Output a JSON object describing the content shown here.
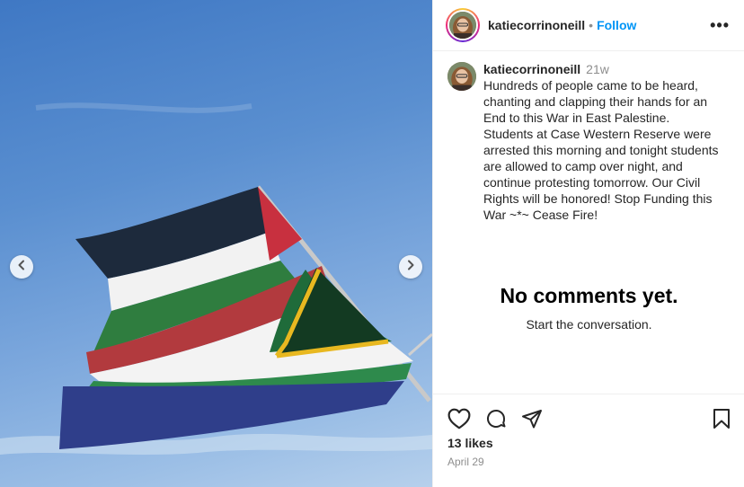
{
  "post": {
    "author": "katiecorrinoneill",
    "follow_label": "Follow",
    "separator": "•",
    "more_label": "•••",
    "caption_author": "katiecorrinoneill",
    "caption_age": "21w",
    "caption_text": "Hundreds of people came to be heard, chanting and clapping their hands for an End to this War in East Palestine. Students at Case Western Reserve were arrested this morning and tonight students are allowed to camp over night, and continue protesting tomorrow. Our Civil Rights will be honored! Stop Funding this War ~*~ Cease Fire!",
    "likes": "13 likes",
    "date": "April 29"
  },
  "comments": {
    "empty_title": "No comments yet.",
    "empty_subtitle": "Start the conversation."
  },
  "icons": {
    "prev": "chevron-left-icon",
    "next": "chevron-right-icon",
    "like": "heart-icon",
    "comment": "comment-icon",
    "share": "share-icon",
    "save": "bookmark-icon"
  },
  "colors": {
    "link": "#0095f6",
    "text": "#262626",
    "muted": "#8e8e8e"
  }
}
